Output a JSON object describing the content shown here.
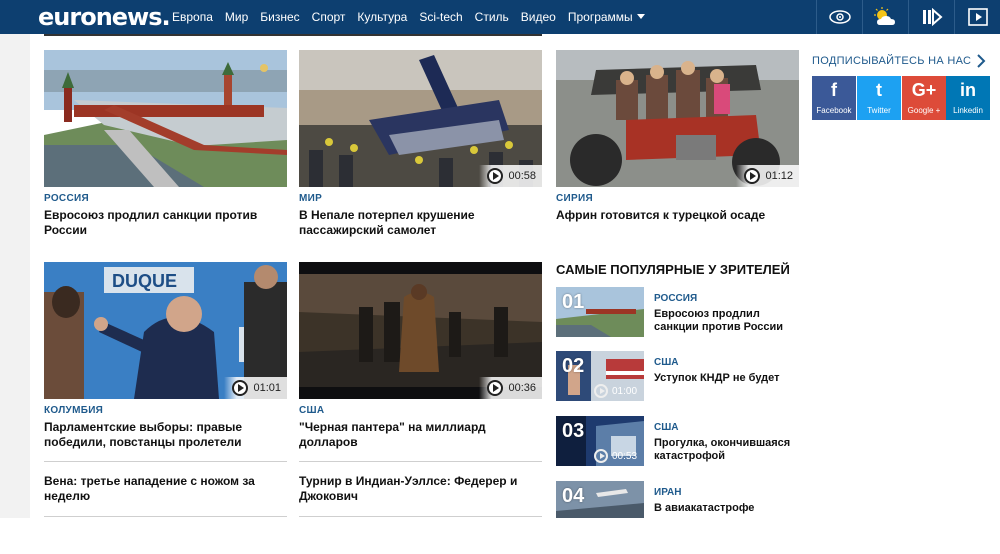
{
  "header": {
    "logo": "euronews.",
    "nav": [
      "Европа",
      "Мир",
      "Бизнес",
      "Спорт",
      "Культура",
      "Sci-tech",
      "Стиль",
      "Видео",
      "Программы"
    ],
    "icons": [
      "eye-icon",
      "weather-icon",
      "livestream-icon",
      "play-video-icon"
    ]
  },
  "cards": [
    {
      "category": "РОССИЯ",
      "title": "Евросоюз продлил санкции против России",
      "duration": ""
    },
    {
      "category": "МИР",
      "title": "В Непале потерпел крушение пассажирский самолет",
      "duration": "00:58"
    },
    {
      "category": "СИРИЯ",
      "title": "Африн готовится к турецкой осаде",
      "duration": "01:12"
    },
    {
      "category": "КОЛУМБИЯ",
      "title": "Парламентские выборы: правые победили, повстанцы пролетели",
      "duration": "01:01"
    },
    {
      "category": "США",
      "title": "\"Черная пантера\" на миллиард долларов",
      "duration": "00:36"
    }
  ],
  "text_items": [
    {
      "title": "Вена: третье нападение с ножом за неделю"
    },
    {
      "title": "Турнир в Индиан-Уэллсе: Федерер и Джокович"
    }
  ],
  "popular": {
    "title": "САМЫЕ ПОПУЛЯРНЫЕ У ЗРИТЕЛЕЙ",
    "items": [
      {
        "num": "01",
        "category": "РОССИЯ",
        "title": "Евросоюз продлил санкции против России",
        "duration": ""
      },
      {
        "num": "02",
        "category": "США",
        "title": "Уступок КНДР не будет",
        "duration": "01:00"
      },
      {
        "num": "03",
        "category": "США",
        "title": "Прогулка, окончившаяся катастрофой",
        "duration": "00:53"
      },
      {
        "num": "04",
        "category": "ИРАН",
        "title": "В авиакатастрофе",
        "duration": ""
      }
    ]
  },
  "subscribe": {
    "title": "ПОДПИСЫВАЙТЕСЬ НА НАС",
    "networks": [
      {
        "glyph": "f",
        "label": "Facebook",
        "color": "#3b5998"
      },
      {
        "glyph": "t",
        "label": "Twitter",
        "color": "#1da1f2"
      },
      {
        "glyph": "G+",
        "label": "Google +",
        "color": "#dd4b39"
      },
      {
        "glyph": "in",
        "label": "Linkedin",
        "color": "#0077b5"
      }
    ]
  },
  "colors": {
    "header_bg": "#0d3f70",
    "category": "#1f5a8c"
  }
}
